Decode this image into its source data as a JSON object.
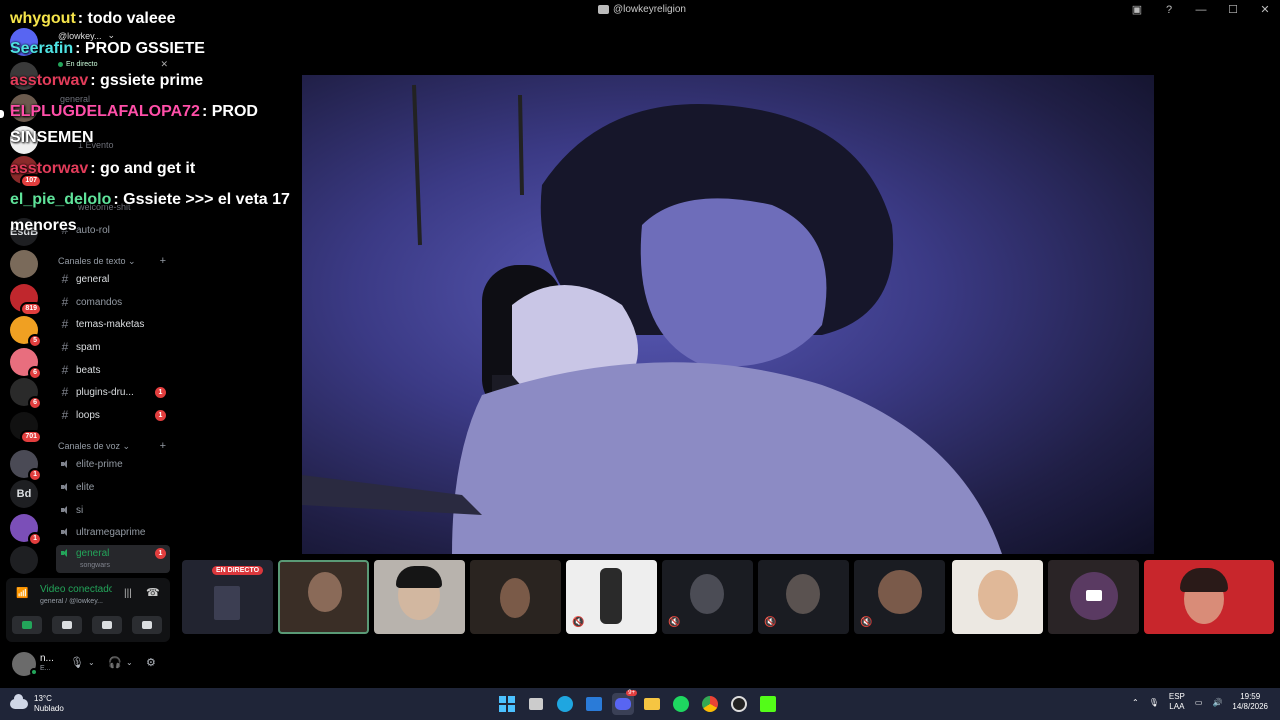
{
  "window": {
    "title": "@lowkeyreligion"
  },
  "rail": {
    "badges": [
      "107",
      "819",
      "5",
      "6",
      "6",
      "701",
      "1",
      "1"
    ],
    "text_servers": [
      "EsdB",
      "Bd"
    ]
  },
  "sidebar": {
    "header": "@lowkey...",
    "live_label": "En directo",
    "ghost_channels": [
      "general",
      "1 Evento",
      "welcome-shit"
    ],
    "auto_rol": "auto-rol",
    "text_category": "Canales de texto",
    "text_channels": [
      {
        "label": "general",
        "unread": ""
      },
      {
        "label": "comandos",
        "unread": ""
      },
      {
        "label": "temas-maketas",
        "unread": ""
      },
      {
        "label": "spam",
        "unread": ""
      },
      {
        "label": "beats",
        "unread": ""
      },
      {
        "label": "plugins-dru...",
        "unread": "1"
      },
      {
        "label": "loops",
        "unread": "1"
      }
    ],
    "voice_category": "Canales de voz",
    "voice_channels": [
      {
        "label": "elite-prime"
      },
      {
        "label": "elite"
      },
      {
        "label": "si"
      },
      {
        "label": "ultramegaprime"
      }
    ],
    "active_voice": {
      "label": "general",
      "sub": "songwars",
      "unread": "1"
    }
  },
  "voice_panel": {
    "title": "Video conectado",
    "subtitle": "general / @lowkey..."
  },
  "user_panel": {
    "name": "n...",
    "status": "E..."
  },
  "chat": [
    {
      "user": "whygout",
      "color": "#f5e44a",
      "text": ": todo valeee"
    },
    {
      "user": "Seerafin",
      "color": "#4fe3e3",
      "text": ": PROD GSSIETE"
    },
    {
      "user": "asstorwav",
      "color": "#e23c5a",
      "text": ": gssiete prime"
    },
    {
      "user": "ELPLUGDELAFALOPA72",
      "color": "#ff4fa8",
      "text": ": PROD SINSEMEN"
    },
    {
      "user": "asstorwav",
      "color": "#e23c5a",
      "text": ": go and get it"
    },
    {
      "user": "el_pie_delolo",
      "color": "#5fe39a",
      "text": ": Gssiete >>> el veta 17 menores"
    }
  ],
  "strip": {
    "live_badge": "EN DIRECTO"
  },
  "taskbar": {
    "temp": "13°C",
    "condition": "Nublado",
    "lang_top": "ESP",
    "lang_bottom": "LAA",
    "time": "19:59",
    "date": "14/8/2026",
    "discord_badge": "9+"
  },
  "colors": {
    "accent_green": "#23a55a",
    "danger": "#da373c",
    "taskbar": "#1f2538"
  }
}
